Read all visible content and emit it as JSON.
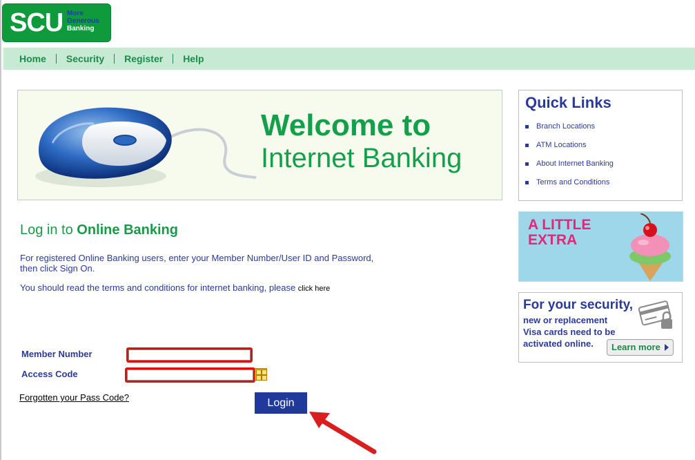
{
  "logo": {
    "abbr": "SCU",
    "tagline": [
      "More",
      "Generous",
      "Banking"
    ]
  },
  "nav": [
    {
      "label": "Home"
    },
    {
      "label": "Security"
    },
    {
      "label": "Register"
    },
    {
      "label": "Help"
    }
  ],
  "banner": {
    "line1": "Welcome to",
    "line2": "Internet Banking"
  },
  "login": {
    "heading_prefix": "Log in to ",
    "heading_bold": "Online Banking",
    "intro": "For registered Online Banking users, enter your Member Number/User ID and Password, then click Sign On.",
    "terms_text": "You should read the terms and conditions for internet banking, please ",
    "terms_link": "click here",
    "member_label": "Member Number",
    "access_label": "Access Code",
    "member_value": "",
    "access_value": "",
    "forgot_link": "Forgotten your Pass Code?",
    "login_button": "Login"
  },
  "quick_links": {
    "title": "Quick Links",
    "items": [
      {
        "label": "Branch Locations"
      },
      {
        "label": "ATM Locations"
      },
      {
        "label": "About Internet Banking"
      },
      {
        "label": "Terms and Conditions"
      }
    ]
  },
  "promo_extra": {
    "line1": "A LITTLE",
    "line2": "EXTRA"
  },
  "promo_security": {
    "title": "For your security,",
    "lines": [
      "new or replacement",
      "Visa cards need to be",
      "activated online."
    ],
    "button": "Learn more"
  },
  "colors": {
    "brand_green": "#0f9a3c",
    "nav_bg": "#c6ead3",
    "text_blue": "#2a3a9a",
    "highlight_red": "#e01010",
    "login_button": "#1f3a9a"
  }
}
